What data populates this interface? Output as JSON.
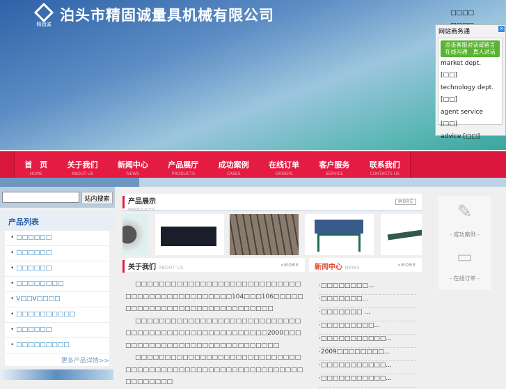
{
  "header": {
    "logo_text": "精固诚",
    "company": "泊头市精固诚量具机械有限公司",
    "links": [
      "□□□□",
      "□□□□"
    ]
  },
  "nav": [
    {
      "cn": "首　页",
      "en": "HOME"
    },
    {
      "cn": "关于我们",
      "en": "ABOUT US"
    },
    {
      "cn": "新闻中心",
      "en": "NEWS"
    },
    {
      "cn": "产品展厅",
      "en": "PRODUCTS"
    },
    {
      "cn": "成功案例",
      "en": "CASES"
    },
    {
      "cn": "在线订单",
      "en": "ORDERS"
    },
    {
      "cn": "客户服务",
      "en": "SERVICE"
    },
    {
      "cn": "联系我们",
      "en": "CONTACTS US"
    }
  ],
  "search": {
    "value": "",
    "button": "站内搜索"
  },
  "product_list": {
    "title": "产品列表",
    "items": [
      "□□□□□□",
      "□□□□□□",
      "□□□□□□",
      "□□□□□□□□",
      "V□□V□□□□",
      "□□□□□□□□□□",
      "□□□□□□",
      "□□□□□□□□□"
    ],
    "more": "更多产品详情>>"
  },
  "products": {
    "title": "产品展示",
    "subtitle": "PRODUCTS",
    "more": "MORE"
  },
  "about": {
    "title": "关于我们",
    "subtitle": "ABOUT US",
    "more": "MORE",
    "paragraphs": [
      "□□□□□□□□□□□□□□□□□□□□□□□□□□□□□□□□□□□□□□□□□□□□□□104□□□106□□□□□□□□□□□□□□□□□□□□□□□□□□□□□□",
      "□□□□□□□□□□□□□□□□□□□□□□□□□□□□□□□□□□□□□□□□□□□□□□□□□□□□2000□□□□□□□□□□□□□□□□□□□□□□□□□□□□□",
      "□□□□□□□□□□□□□□□□□□□□□□□□□□□□□□□□□□□□□□□□□□□□□□□□□□□□□□□□□□□□□□□□□□"
    ]
  },
  "news": {
    "title": "新闻中心",
    "subtitle": "NEWS",
    "more": "MORE",
    "items": [
      "·□□□□□□□□...",
      "·□□□□□□□...",
      "·□□□□□□□ ...",
      "·□□□□□□□□□...",
      "·□□□□□□□□□□□...",
      "·2009□□□□□□□□...",
      "·□□□□□□□□□□□...",
      "·□□□□□□□□□□□..."
    ]
  },
  "right": {
    "cases": "- 成功案例 -",
    "orders": "- 在线订单 -"
  },
  "chat": {
    "title": "网站商务通",
    "cta_line1": "点击客服对话或留言",
    "cta_line2": "在线沟通　真人对话",
    "links": [
      "market dept. [□□]",
      "technology dept. [□□]",
      "agent service [□□]",
      "advice [□□]"
    ]
  }
}
